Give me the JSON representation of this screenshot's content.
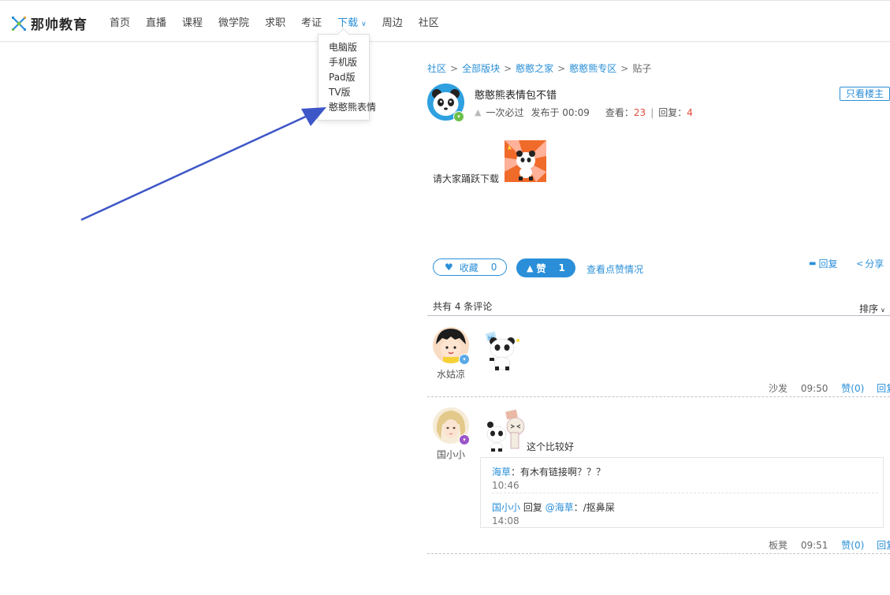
{
  "brand": {
    "name": "那帅教育"
  },
  "nav": {
    "items": [
      "首页",
      "直播",
      "课程",
      "微学院",
      "求职",
      "考证",
      "下载",
      "周边",
      "社区"
    ],
    "active_index": 6
  },
  "download_menu": {
    "items": [
      "电脑版",
      "手机版",
      "Pad版",
      "TV版",
      "憨憨熊表情"
    ]
  },
  "breadcrumb": {
    "items": [
      "社区",
      "全部版块",
      "憨憨之家",
      "憨憨熊专区"
    ],
    "current": "贴子",
    "separator": ">"
  },
  "post": {
    "title": "憨憨熊表情包不错",
    "author": "一次必过",
    "published": "发布于 00:09",
    "views_label": "查看：",
    "views": "23",
    "replies_label": "回复：",
    "replies": "4",
    "only_owner": "只看楼主",
    "body": "请大家踊跃下载"
  },
  "actions": {
    "favorite_label": "收藏",
    "favorite_count": "0",
    "like_label": "赞",
    "like_count": "1",
    "view_likes": "查看点赞情况",
    "reply": "回复",
    "share": "分享"
  },
  "comments_header": {
    "count_text": "共有 4 条评论",
    "sort": "排序"
  },
  "comments": [
    {
      "user": "水姑凉",
      "floor": "沙发",
      "time": "09:50",
      "like": "赞(0)",
      "reply": "回复",
      "text": ""
    },
    {
      "user": "国小小",
      "floor": "板凳",
      "time": "09:51",
      "like": "赞(0)",
      "reply": "回复",
      "text": "这个比较好"
    }
  ],
  "nested_replies": [
    {
      "user": "海草",
      "sep": "：",
      "text": "有木有链接啊？？？",
      "time": "10:46"
    },
    {
      "user": "国小小",
      "verb": " 回复 ",
      "target": "@海草",
      "sep": "：",
      "text": "/抠鼻屎",
      "time": "14:08"
    }
  ],
  "colors": {
    "accent": "#2a8fd8",
    "count_red": "#e04a3a",
    "arrow": "#3d56c8"
  }
}
